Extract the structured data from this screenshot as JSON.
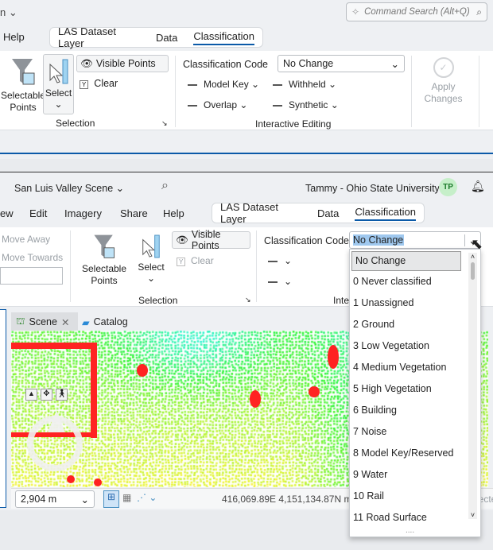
{
  "top": {
    "app_menu_fragment": "n",
    "search_placeholder": "Command Search (Alt+Q)",
    "menu_help": "Help",
    "context_tabs": [
      "LAS Dataset Layer",
      "Data",
      "Classification"
    ],
    "selectable_points": "Selectable Points",
    "select": "Select",
    "visible_points": "Visible Points",
    "clear": "Clear",
    "selection_group": "Selection",
    "classification_code_label": "Classification Code",
    "classification_code_value": "No Change",
    "model_key": "Model Key",
    "withheld": "Withheld",
    "overlap": "Overlap",
    "synthetic": "Synthetic",
    "interactive_editing_group": "Interactive Editing",
    "apply_changes": "Apply Changes"
  },
  "bottom": {
    "project_title": "San Luis Valley Scene",
    "user": "Tammy - Ohio State University",
    "avatar_initials": "TP",
    "menu": [
      "ew",
      "Edit",
      "Imagery",
      "Share",
      "Help"
    ],
    "context_tabs": [
      "LAS Dataset Layer",
      "Data",
      "Classification"
    ],
    "move_away": "Move Away",
    "move_towards": "Move Towards",
    "selectable_points": "Selectable Points",
    "select": "Select",
    "visible_points": "Visible Points",
    "clear": "Clear",
    "selection_group": "Selection",
    "classification_code_label": "Classification Code",
    "classification_code_value": "No Change",
    "interactive_group_fragment": "Inte",
    "view_tabs": [
      "Scene",
      "Catalog"
    ],
    "scale": "2,904 m",
    "coordinates": "416,069.89E 4,151,134.87N m",
    "status_fragment": "lecte",
    "dropdown_options": [
      "No Change",
      "0 Never classified",
      "1 Unassigned",
      "2 Ground",
      "3 Low Vegetation",
      "4 Medium Vegetation",
      "5 High Vegetation",
      "6 Building",
      "7 Noise",
      "8 Model Key/Reserved",
      "9 Water",
      "10 Rail",
      "11 Road Surface"
    ],
    "dropdown_more": "....",
    "colors": {
      "accent": "#0b5aa8",
      "avatar_bg": "#c6efc9",
      "avatar_fg": "#1b7a2a"
    }
  }
}
